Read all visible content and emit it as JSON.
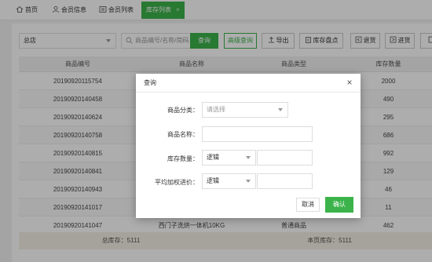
{
  "tabs": [
    {
      "label": "首页",
      "icon": "home-icon"
    },
    {
      "label": "会员信息",
      "icon": "user-icon"
    },
    {
      "label": "会员列表",
      "icon": "list-icon"
    },
    {
      "label": "库存列表",
      "icon": "",
      "active": true,
      "close": "×"
    }
  ],
  "toolbar": {
    "store_select": "总店",
    "search_placeholder": "商品编号/名称/简码",
    "query_button": "查询",
    "advanced_query_button": "高级查询",
    "export_button": "导出",
    "inventory_check_button": "库存盘点",
    "return_button": "退货",
    "purchase_button": "进货"
  },
  "table": {
    "headers": [
      "商品编号",
      "商品名称",
      "商品类型",
      "库存数量"
    ],
    "rows": [
      [
        "20190920115754",
        "",
        "",
        "2000"
      ],
      [
        "20190920140458",
        "",
        "",
        "490"
      ],
      [
        "20190920140624",
        "",
        "",
        "295"
      ],
      [
        "20190920140758",
        "",
        "",
        "686"
      ],
      [
        "20190920140815",
        "",
        "",
        "992"
      ],
      [
        "20190920140841",
        "",
        "",
        "129"
      ],
      [
        "20190920140943",
        "",
        "",
        "46"
      ],
      [
        "20190920141017",
        "",
        "",
        "11"
      ],
      [
        "20190920141047",
        "西门子洗烘一体机10KG",
        "普通商品",
        "462"
      ]
    ],
    "footer_total": "总库存：5111",
    "footer_page": "本页库存：5111"
  },
  "dialog": {
    "title": "查询",
    "close": "×",
    "category_label": "商品分类：",
    "category_placeholder": "请选择",
    "name_label": "商品名称：",
    "stock_label": "库存数量：",
    "stock_operator": "逻辑",
    "avg_price_label": "平均加权进价：",
    "avg_price_operator": "逻辑",
    "cancel_button": "取消",
    "confirm_button": "确认"
  },
  "colors": {
    "accent": "#3cb34a",
    "overlay": "rgba(0,0,0,0.32)",
    "footer_bg": "#f5f0e6"
  }
}
